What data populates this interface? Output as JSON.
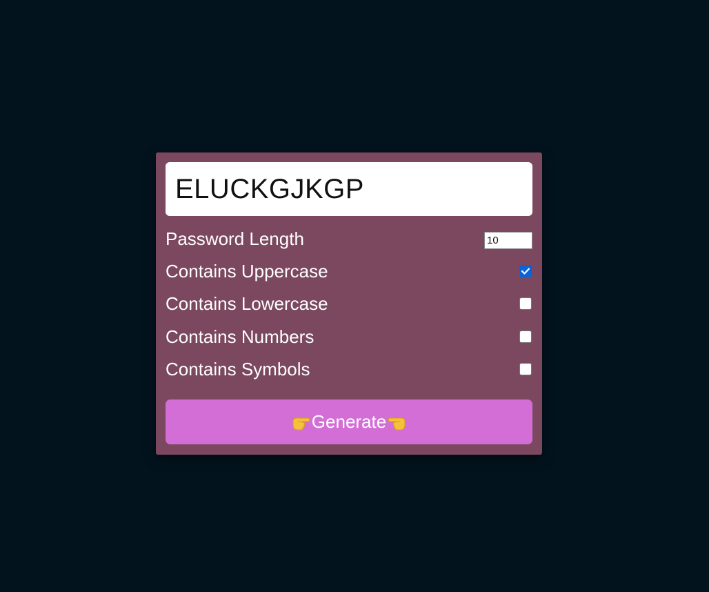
{
  "generator": {
    "password": "ELUCKGJKGP",
    "length_label": "Password Length",
    "length_value": "10",
    "options": [
      {
        "label": "Contains Uppercase",
        "checked": true
      },
      {
        "label": "Contains Lowercase",
        "checked": false
      },
      {
        "label": "Contains Numbers",
        "checked": false
      },
      {
        "label": "Contains Symbols",
        "checked": false
      }
    ],
    "generate_label": "Generate",
    "generate_left_icon": "pointing-right-hand-icon",
    "generate_right_icon": "pointing-left-hand-icon"
  },
  "colors": {
    "background": "#03131e",
    "card": "#7b485f",
    "button": "#d36ed6",
    "checkbox_checked": "#0a64d8"
  }
}
